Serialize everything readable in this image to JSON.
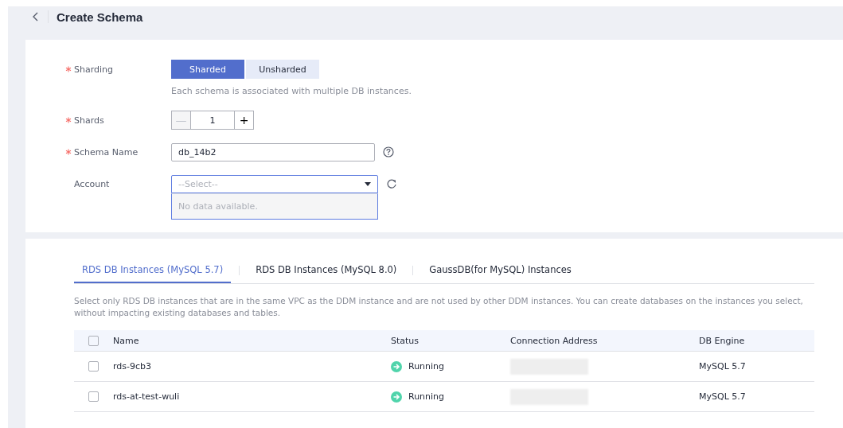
{
  "header": {
    "title": "Create Schema"
  },
  "form": {
    "sharding": {
      "label": "Sharding",
      "required": true,
      "options": [
        {
          "label": "Sharded",
          "selected": true
        },
        {
          "label": "Unsharded",
          "selected": false
        }
      ],
      "hint": "Each schema is associated with multiple DB instances."
    },
    "shards": {
      "label": "Shards",
      "required": true,
      "value": "1",
      "minus": "—",
      "plus": "+"
    },
    "schema_name": {
      "label": "Schema Name",
      "required": true,
      "value": "db_14b2"
    },
    "account": {
      "label": "Account",
      "required": false,
      "placeholder": "--Select--",
      "dropdown_message": "No data available."
    }
  },
  "instances": {
    "tabs": [
      {
        "label": "RDS DB Instances (MySQL 5.7)",
        "selected": true
      },
      {
        "label": "RDS DB Instances (MySQL 8.0)",
        "selected": false
      },
      {
        "label": "GaussDB(for MySQL) Instances",
        "selected": false
      }
    ],
    "note": "Select only RDS DB instances that are in the same VPC as the DDM instance and are not used by other DDM instances. You can create databases on the instances you select, without impacting existing databases and tables.",
    "table": {
      "columns": [
        "Name",
        "Status",
        "Connection Address",
        "DB Engine"
      ],
      "all_checked": false,
      "rows": [
        {
          "checked": false,
          "name": "rds-9cb3",
          "status": "Running",
          "engine": "MySQL 5.7"
        },
        {
          "checked": false,
          "name": "rds-at-test-wuli",
          "status": "Running",
          "engine": "MySQL 5.7"
        }
      ]
    }
  }
}
